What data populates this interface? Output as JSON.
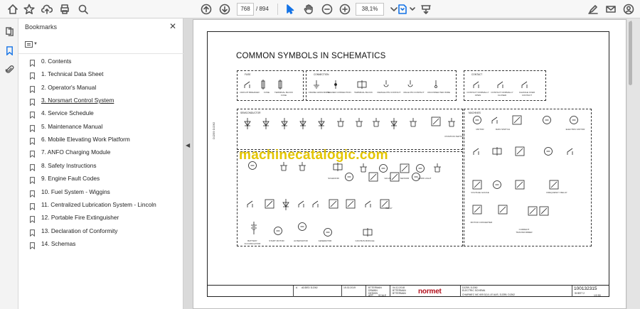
{
  "toolbar": {
    "page_current": "768",
    "page_total": "/ 894",
    "zoom": "38,1%"
  },
  "panel": {
    "title": "Bookmarks",
    "close_glyph": "✕"
  },
  "bookmarks": [
    {
      "label": "0. Contents"
    },
    {
      "label": "1. Technical Data Sheet"
    },
    {
      "label": "2. Operator's Manual"
    },
    {
      "label": "3. Norsmart Control System"
    },
    {
      "label": "4. Service Schedule"
    },
    {
      "label": "5. Maintenance Manual"
    },
    {
      "label": "6. Mobile Elevating Work Platform"
    },
    {
      "label": "7. ANFO Charging Module"
    },
    {
      "label": "8. Safety Instructions"
    },
    {
      "label": "9. Engine Fault Codes"
    },
    {
      "label": "10. Fuel System - Wiggins"
    },
    {
      "label": "11. Centralized Lubrication System - Lincoln"
    },
    {
      "label": "12. Portable Fire Extinguisher"
    },
    {
      "label": "13. Declaration of Conformity"
    },
    {
      "label": "14. Schemas"
    }
  ],
  "document": {
    "heading": "COMMON SYMBOLS IN SCHEMATICS",
    "watermark": "machinecatalogic.com",
    "sections": {
      "fuse": "FUSE",
      "connection": "CONNECTION",
      "contact": "CONTACT",
      "semiconductor": "SEMICONDUCTOR",
      "machines": "MACHINES"
    },
    "captions": {
      "c1": "CIRCUIT BREAKER",
      "c2": "FUSE",
      "c3": "TERMINAL BLOCK FUSE",
      "c4": "FRAME GROUNDING",
      "c5": "SOLDER CONNECTION",
      "c6": "TERMINAL BLOCK",
      "c7": "FEMALE PIN CONTACT",
      "c8": "MALE PIN CONTACT",
      "c9": "UNCONNECTED WIRE",
      "c10": "CONTACT NORMALLY OPEN",
      "c11": "CONTACT NORMALLY CLOSED",
      "c12": "CHANGE OVER CONTACT",
      "c13": "MOTOR",
      "c14": "ELECTRIC MOTOR",
      "c15": "VALVE",
      "c16": "SENSOR",
      "c17": "WORK LIGHT",
      "c18": "SOLENOID",
      "c19": "RELAY",
      "c20": "BATTERY ACCUMULATOR",
      "c21": "START MOTOR",
      "c22": "ALTERNATOR",
      "c23": "GENERATOR",
      "c24": "CAN BUS MODULE",
      "c25": "MAIN SWITCH",
      "c26": "POSITION SWITCH",
      "c27": "VOLTAGE GAUGE",
      "c28": "MOTOR CONVERTER",
      "c29": "CURRENT TRANSFORMER",
      "c30": "FREQUENCY RELAY"
    },
    "vertical_label": "DJ259 DJ262",
    "titleblock": {
      "rev": "A",
      "by": "ADDED DJ262",
      "date1": "15.02.2019",
      "name1": "BTTERMAN",
      "date2": "04.12.2018",
      "r1": "DRAWN",
      "r2": "DESIGN",
      "r3": "APP",
      "r4": "SCALE",
      "n1": "BTTERMAN",
      "n2": "BTTERMAN",
      "project": "DJ259, DJ262",
      "desc1": "ELECTRIC SCHEMA",
      "desc2": "CHARMEC MC 605 D(V) LE AUS, DJ259, DJ262",
      "brand": "normet",
      "docnum": "100132315",
      "sheet": "SHEET 2",
      "page": "1/3 3D"
    }
  },
  "colors": {
    "accent": "#1473e6",
    "watermark": "#e4c500",
    "brand": "#b3121e"
  }
}
